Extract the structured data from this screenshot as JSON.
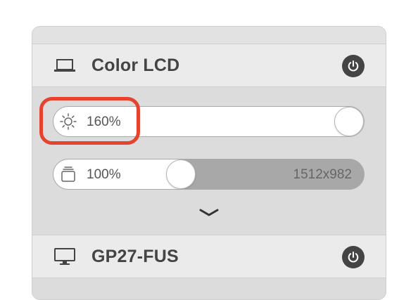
{
  "displays": [
    {
      "name": "Color LCD",
      "icon": "laptop-icon",
      "power_icon": "power-icon",
      "brightness": {
        "icon": "sun-icon",
        "value_text": "160%",
        "level": 1.0
      },
      "resolution": {
        "icon": "layers-icon",
        "scale_text": "100%",
        "size_text": "1512x982",
        "level": 0.4
      },
      "expand_icon": "chevron-down-icon"
    },
    {
      "name": "GP27-FUS",
      "icon": "monitor-icon",
      "power_icon": "power-icon"
    }
  ],
  "colors": {
    "highlight": "#e5432e",
    "power_button": "#444444",
    "panel": "#dcdcdc",
    "header": "#ebebeb"
  }
}
